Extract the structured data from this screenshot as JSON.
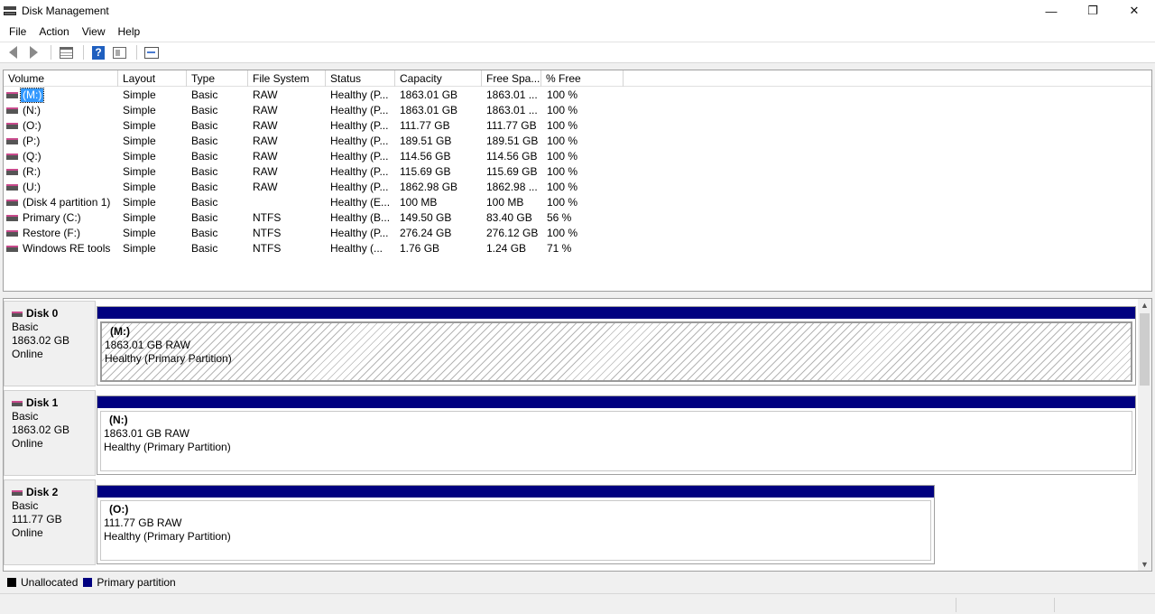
{
  "window": {
    "title": "Disk Management",
    "minimize": "—",
    "restore": "❐",
    "close": "✕"
  },
  "menu": [
    "File",
    "Action",
    "View",
    "Help"
  ],
  "toolbar": {
    "buttons": [
      "back-arrow-icon",
      "forward-arrow-icon",
      "list-view-icon",
      "help-icon",
      "properties-icon",
      "console-view-icon"
    ],
    "help_glyph": "?"
  },
  "columns": [
    "Volume",
    "Layout",
    "Type",
    "File System",
    "Status",
    "Capacity",
    "Free Spa...",
    "% Free"
  ],
  "volumes": [
    {
      "volume": "(M:)",
      "layout": "Simple",
      "type": "Basic",
      "fs": "RAW",
      "status": "Healthy (P...",
      "capacity": "1863.01 GB",
      "free": "1863.01 ...",
      "pct": "100 %",
      "selected": true
    },
    {
      "volume": "(N:)",
      "layout": "Simple",
      "type": "Basic",
      "fs": "RAW",
      "status": "Healthy (P...",
      "capacity": "1863.01 GB",
      "free": "1863.01 ...",
      "pct": "100 %"
    },
    {
      "volume": "(O:)",
      "layout": "Simple",
      "type": "Basic",
      "fs": "RAW",
      "status": "Healthy (P...",
      "capacity": "111.77 GB",
      "free": "111.77 GB",
      "pct": "100 %"
    },
    {
      "volume": "(P:)",
      "layout": "Simple",
      "type": "Basic",
      "fs": "RAW",
      "status": "Healthy (P...",
      "capacity": "189.51 GB",
      "free": "189.51 GB",
      "pct": "100 %"
    },
    {
      "volume": "(Q:)",
      "layout": "Simple",
      "type": "Basic",
      "fs": "RAW",
      "status": "Healthy (P...",
      "capacity": "114.56 GB",
      "free": "114.56 GB",
      "pct": "100 %"
    },
    {
      "volume": "(R:)",
      "layout": "Simple",
      "type": "Basic",
      "fs": "RAW",
      "status": "Healthy (P...",
      "capacity": "115.69 GB",
      "free": "115.69 GB",
      "pct": "100 %"
    },
    {
      "volume": "(U:)",
      "layout": "Simple",
      "type": "Basic",
      "fs": "RAW",
      "status": "Healthy (P...",
      "capacity": "1862.98 GB",
      "free": "1862.98 ...",
      "pct": "100 %"
    },
    {
      "volume": "(Disk 4 partition 1)",
      "layout": "Simple",
      "type": "Basic",
      "fs": "",
      "status": "Healthy (E...",
      "capacity": "100 MB",
      "free": "100 MB",
      "pct": "100 %"
    },
    {
      "volume": "Primary (C:)",
      "layout": "Simple",
      "type": "Basic",
      "fs": "NTFS",
      "status": "Healthy (B...",
      "capacity": "149.50 GB",
      "free": "83.40 GB",
      "pct": "56 %"
    },
    {
      "volume": "Restore (F:)",
      "layout": "Simple",
      "type": "Basic",
      "fs": "NTFS",
      "status": "Healthy (P...",
      "capacity": "276.24 GB",
      "free": "276.12 GB",
      "pct": "100 %"
    },
    {
      "volume": "Windows RE tools",
      "layout": "Simple",
      "type": "Basic",
      "fs": "NTFS",
      "status": "Healthy (...",
      "capacity": "1.76 GB",
      "free": "1.24 GB",
      "pct": "71 %"
    }
  ],
  "disks": [
    {
      "name": "Disk 0",
      "type": "Basic",
      "size": "1863.02 GB",
      "state": "Online",
      "partition": {
        "name": "(M:)",
        "size": "1863.01 GB RAW",
        "status": "Healthy (Primary Partition)",
        "selected": true
      }
    },
    {
      "name": "Disk 1",
      "type": "Basic",
      "size": "1863.02 GB",
      "state": "Online",
      "partition": {
        "name": "(N:)",
        "size": "1863.01 GB RAW",
        "status": "Healthy (Primary Partition)"
      }
    },
    {
      "name": "Disk 2",
      "type": "Basic",
      "size": "111.77 GB",
      "state": "Online",
      "partition": {
        "name": "(O:)",
        "size": "111.77 GB RAW",
        "status": "Healthy (Primary Partition)"
      }
    }
  ],
  "legend": [
    {
      "label": "Unallocated",
      "color": "#000000"
    },
    {
      "label": "Primary partition",
      "color": "#000080"
    }
  ],
  "colors": {
    "primary_partition": "#000080",
    "unallocated": "#000000",
    "selection": "#3399ff"
  }
}
